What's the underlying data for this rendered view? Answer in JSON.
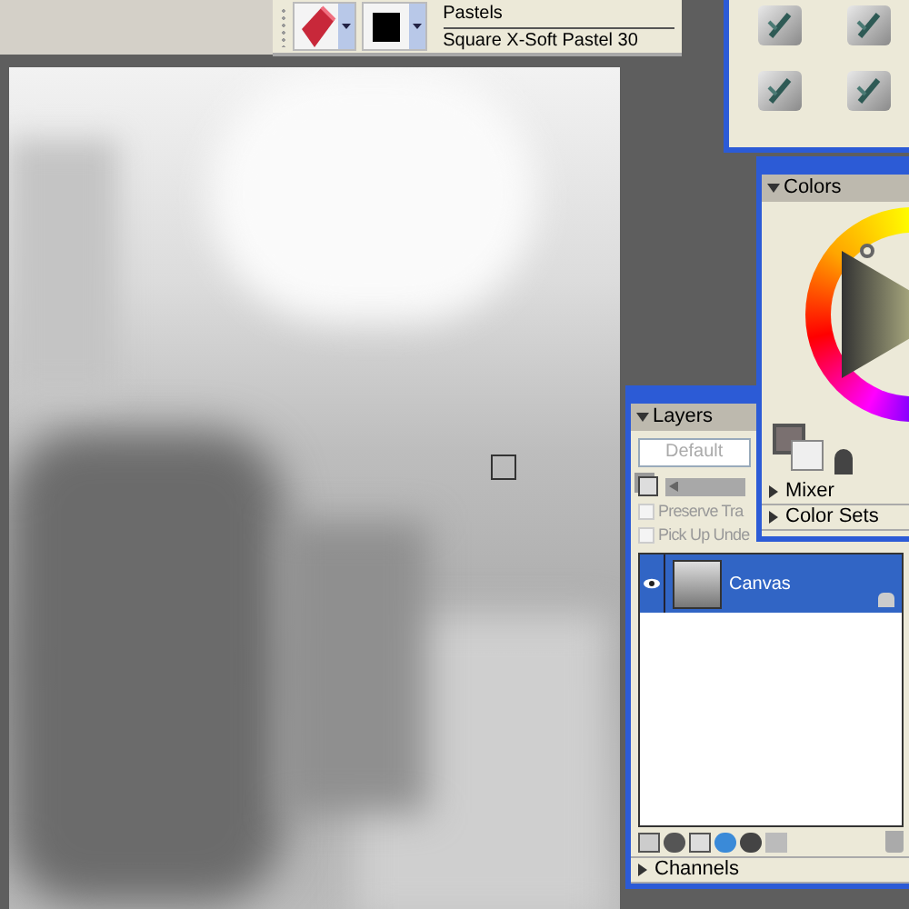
{
  "property_bar": {
    "brush_category": "Pastels",
    "brush_variant": "Square X-Soft Pastel 30"
  },
  "colors_panel": {
    "title": "Colors",
    "expanded": true,
    "sections": [
      {
        "label": "Mixer",
        "expanded": false
      },
      {
        "label": "Color Sets",
        "expanded": false
      }
    ]
  },
  "layers_panel": {
    "title": "Layers",
    "expanded": true,
    "composite_method": {
      "placeholder": "Default"
    },
    "opacity_slider": {
      "level": 0,
      "disabled": true
    },
    "options": [
      {
        "label": "Preserve Tra",
        "checked": false,
        "disabled": true
      },
      {
        "label": "Pick Up Unde",
        "checked": false,
        "disabled": true
      }
    ],
    "layers": [
      {
        "name": "Canvas",
        "selected": true,
        "visible": true,
        "locked": true
      }
    ],
    "sections": [
      {
        "label": "Channels",
        "expanded": false
      }
    ]
  }
}
